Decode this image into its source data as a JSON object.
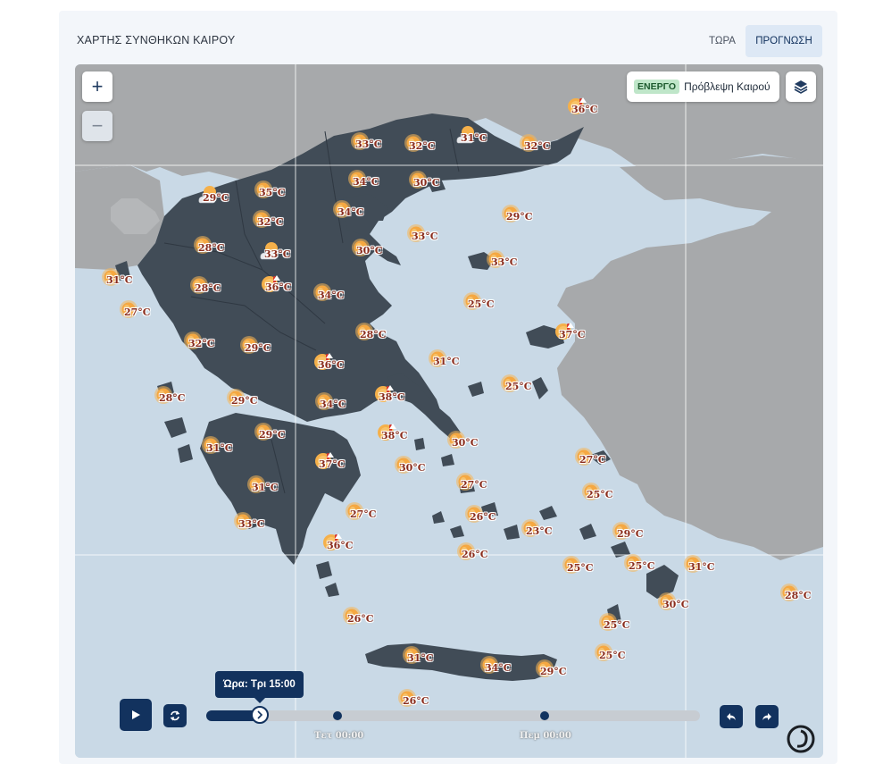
{
  "header": {
    "title": "ΧΑΡΤΗΣ ΣΥΝΘΗΚΩΝ ΚΑΙΡΟΥ",
    "tabs": [
      {
        "label": "ΤΩΡΑ",
        "active": false
      },
      {
        "label": "ΠΡΟΓΝΩΣΗ",
        "active": true
      }
    ]
  },
  "map": {
    "zoom_in_label": "+",
    "zoom_out_label": "−",
    "active_layer": {
      "badge": "ΕΝΕΡΓΟ",
      "label": "Πρόβλεψη Καιρού"
    },
    "layers_icon": "layers-icon",
    "temp_unit": "°C",
    "stations": [
      {
        "t": "33",
        "icon": "sun"
      },
      {
        "t": "32",
        "icon": "sun"
      },
      {
        "t": "31",
        "icon": "cloud-sun"
      },
      {
        "t": "32",
        "icon": "sun"
      },
      {
        "t": "36",
        "icon": "hot"
      },
      {
        "t": "29",
        "icon": "cloud-sun"
      },
      {
        "t": "35",
        "icon": "sun"
      },
      {
        "t": "34",
        "icon": "sun"
      },
      {
        "t": "30",
        "icon": "sun"
      },
      {
        "t": "32",
        "icon": "sun"
      },
      {
        "t": "34",
        "icon": "sun"
      },
      {
        "t": "29",
        "icon": "sun"
      },
      {
        "t": "28",
        "icon": "sun"
      },
      {
        "t": "33",
        "icon": "cloud-sun"
      },
      {
        "t": "30",
        "icon": "sun"
      },
      {
        "t": "33",
        "icon": "sun"
      },
      {
        "t": "33",
        "icon": "sun"
      },
      {
        "t": "31",
        "icon": "sun"
      },
      {
        "t": "28",
        "icon": "sun"
      },
      {
        "t": "36",
        "icon": "hot"
      },
      {
        "t": "34",
        "icon": "sun"
      },
      {
        "t": "25",
        "icon": "sun"
      },
      {
        "t": "27",
        "icon": "sun"
      },
      {
        "t": "28",
        "icon": "sun"
      },
      {
        "t": "32",
        "icon": "sun"
      },
      {
        "t": "29",
        "icon": "sun"
      },
      {
        "t": "37",
        "icon": "hot"
      },
      {
        "t": "31",
        "icon": "sun"
      },
      {
        "t": "36",
        "icon": "hot"
      },
      {
        "t": "28",
        "icon": "sun"
      },
      {
        "t": "29",
        "icon": "sun"
      },
      {
        "t": "34",
        "icon": "sun"
      },
      {
        "t": "38",
        "icon": "hot"
      },
      {
        "t": "25",
        "icon": "sun"
      },
      {
        "t": "29",
        "icon": "sun"
      },
      {
        "t": "38",
        "icon": "hot"
      },
      {
        "t": "31",
        "icon": "sun"
      },
      {
        "t": "30",
        "icon": "sun"
      },
      {
        "t": "37",
        "icon": "hot"
      },
      {
        "t": "30",
        "icon": "sun"
      },
      {
        "t": "27",
        "icon": "sun"
      },
      {
        "t": "27",
        "icon": "sun"
      },
      {
        "t": "31",
        "icon": "sun"
      },
      {
        "t": "25",
        "icon": "sun"
      },
      {
        "t": "27",
        "icon": "sun"
      },
      {
        "t": "26",
        "icon": "sun"
      },
      {
        "t": "33",
        "icon": "sun"
      },
      {
        "t": "23",
        "icon": "sun"
      },
      {
        "t": "29",
        "icon": "sun"
      },
      {
        "t": "26",
        "icon": "sun"
      },
      {
        "t": "36",
        "icon": "hot"
      },
      {
        "t": "25",
        "icon": "sun"
      },
      {
        "t": "25",
        "icon": "sun"
      },
      {
        "t": "31",
        "icon": "sun"
      },
      {
        "t": "28",
        "icon": "sun"
      },
      {
        "t": "30",
        "icon": "sun"
      },
      {
        "t": "26",
        "icon": "sun"
      },
      {
        "t": "25",
        "icon": "sun"
      },
      {
        "t": "25",
        "icon": "sun"
      },
      {
        "t": "31",
        "icon": "sun"
      },
      {
        "t": "34",
        "icon": "sun"
      },
      {
        "t": "29",
        "icon": "sun"
      },
      {
        "t": "26",
        "icon": "sun"
      }
    ]
  },
  "timeline": {
    "tooltip": "Ώρα: Τρι 15:00",
    "progress": 0.11,
    "markers": [
      {
        "label": "Τετ 00:00",
        "fraction": 0.265
      },
      {
        "label": "Πεμ 00:00",
        "fraction": 0.685
      }
    ],
    "play_icon": "play-icon",
    "loop_icon": "loop-icon",
    "back_icon": "rewind-icon",
    "forward_icon": "forward-icon"
  },
  "colors": {
    "land_greece": "#414c57",
    "land_other": "#a7a9ab",
    "sea": "#c9d9e6",
    "accent": "#12325e",
    "sun": "#f5b04a"
  }
}
